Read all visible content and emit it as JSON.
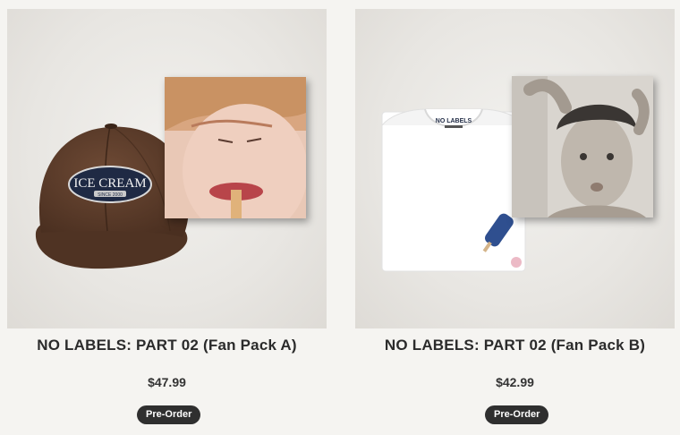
{
  "products": [
    {
      "title": "NO LABELS: PART 02 (Fan Pack A)",
      "price": "$47.99",
      "badge": "Pre-Order",
      "cap_patch_text": "ICE CREAM",
      "cap_patch_subtext": "SINCE 2000"
    },
    {
      "title": "NO LABELS: PART 02 (Fan Pack B)",
      "price": "$42.99",
      "badge": "Pre-Order",
      "shirt_label_text": "NO LABELS"
    }
  ]
}
